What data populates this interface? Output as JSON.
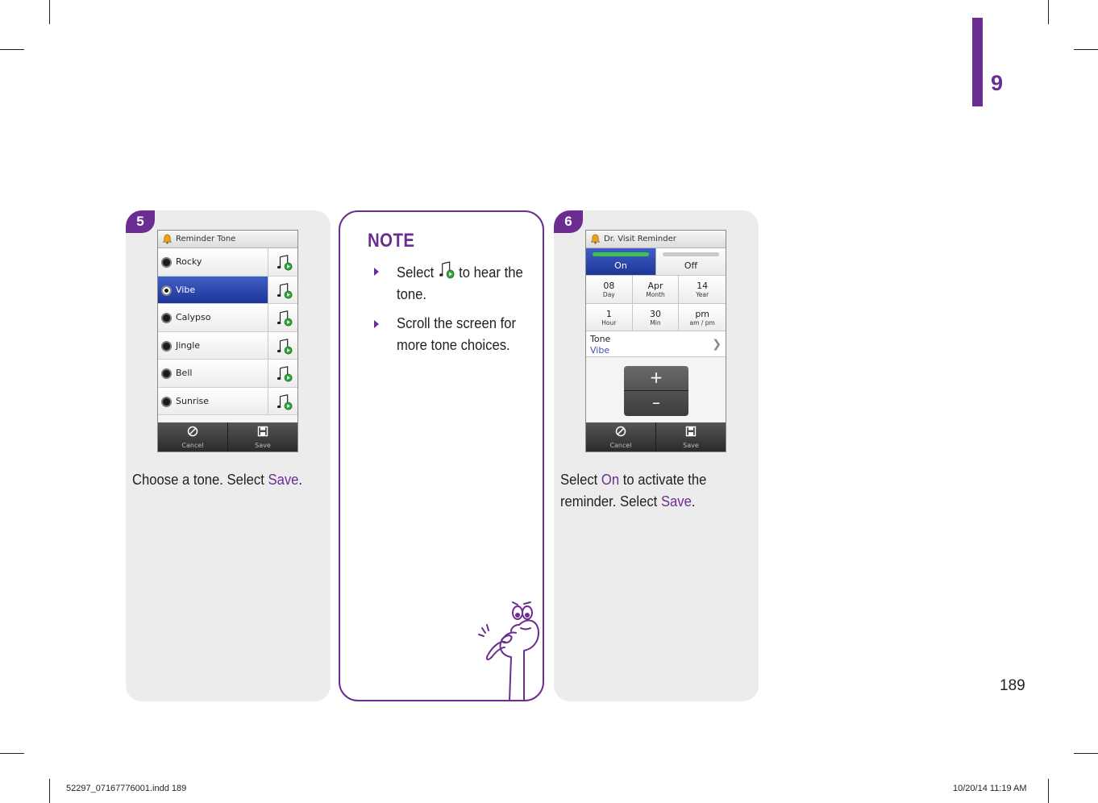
{
  "chapter": {
    "number": "9",
    "color": "#6b2d91"
  },
  "page_number": "189",
  "step5": {
    "badge": "5",
    "screen": {
      "title": "Reminder Tone",
      "tones": [
        {
          "label": "Rocky",
          "selected": false
        },
        {
          "label": "Vibe",
          "selected": true
        },
        {
          "label": "Calypso",
          "selected": false
        },
        {
          "label": "Jingle",
          "selected": false
        },
        {
          "label": "Bell",
          "selected": false
        },
        {
          "label": "Sunrise",
          "selected": false
        }
      ],
      "cancel_label": "Cancel",
      "save_label": "Save"
    },
    "text_before": "Choose a tone. Select ",
    "text_highlight": "Save",
    "text_after": "."
  },
  "note": {
    "title": "NOTE",
    "item1_before": "Select ",
    "item1_after": " to hear the tone.",
    "item2": "Scroll the screen for more tone choices."
  },
  "step6": {
    "badge": "6",
    "screen": {
      "title": "Dr. Visit Reminder",
      "on_label": "On",
      "off_label": "Off",
      "fields": [
        {
          "value": "08",
          "label": "Day"
        },
        {
          "value": "Apr",
          "label": "Month"
        },
        {
          "value": "14",
          "label": "Year"
        },
        {
          "value": "1",
          "label": "Hour"
        },
        {
          "value": "30",
          "label": "Min"
        },
        {
          "value": "pm",
          "label": "am / pm"
        }
      ],
      "tone_label": "Tone",
      "tone_value": "Vibe",
      "plus": "+",
      "minus": "–",
      "cancel_label": "Cancel",
      "save_label": "Save"
    },
    "line1_before": "Select ",
    "line1_highlight": "On",
    "line1_after": " to activate the",
    "line2_before": "reminder. Select ",
    "line2_highlight": "Save",
    "line2_after": "."
  },
  "slug": {
    "file": "52297_07167776001.indd   189",
    "date": "10/20/14   11:19 AM"
  }
}
